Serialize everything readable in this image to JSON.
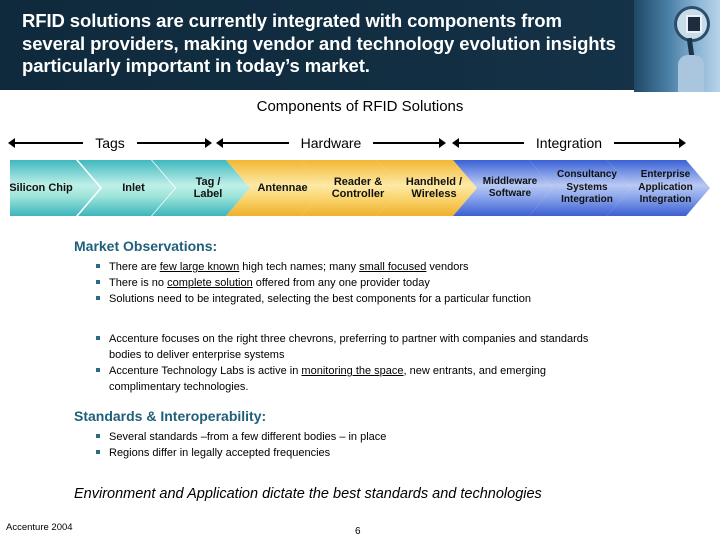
{
  "header": {
    "title": "RFID solutions are currently integrated with components from several providers, making vendor and technology evolution insights particularly important in today’s market.",
    "image": "magnifying-glass-icon"
  },
  "diagram": {
    "title": "Components of RFID Solutions",
    "categories": [
      "Tags",
      "Hardware",
      "Integration"
    ],
    "chevrons": [
      {
        "label": "Silicon Chip",
        "group": "Tags"
      },
      {
        "label": "Inlet",
        "group": "Tags"
      },
      {
        "label": "Tag / Label",
        "group": "Tags"
      },
      {
        "label": "Antennae",
        "group": "Hardware"
      },
      {
        "label": "Reader & Controller",
        "group": "Hardware"
      },
      {
        "label": "Handheld / Wireless",
        "group": "Hardware"
      },
      {
        "label": "Middleware Software",
        "group": "Integration"
      },
      {
        "label": "Consultancy Systems Integration",
        "group": "Integration"
      },
      {
        "label": "Enterprise Application Integration",
        "group": "Integration"
      }
    ],
    "colors": {
      "tags": "#3fb8bf",
      "hardware": "#f2b733",
      "integration": "#3a62d6"
    }
  },
  "market": {
    "heading": "Market Observations:",
    "bullets": [
      {
        "pre": "There are ",
        "u1": "few large known",
        "mid": " high tech names;  many ",
        "u2": "small focused",
        "post": " vendors"
      },
      {
        "pre": "There is no ",
        "u1": "complete solution",
        "post": " offered from any one provider today"
      },
      {
        "text": "Solutions need to be integrated, selecting the best components for a particular function"
      }
    ],
    "accenture_bullets": [
      {
        "text": "Accenture focuses on the right three chevrons,  preferring to partner with companies and standards bodies to deliver enterprise systems"
      },
      {
        "pre": "Accenture Technology Labs is active in ",
        "u1": "monitoring the space",
        "post": ", new entrants, and emerging complimentary technologies."
      }
    ]
  },
  "standards": {
    "heading": "Standards & Interoperability:",
    "bullets": [
      "Several standards –from a few different bodies – in place",
      "Regions differ in legally accepted frequencies"
    ]
  },
  "tagline": "Environment and Application dictate the best standards and technologies",
  "footer": {
    "left": "Accenture 2004",
    "page": "6"
  }
}
